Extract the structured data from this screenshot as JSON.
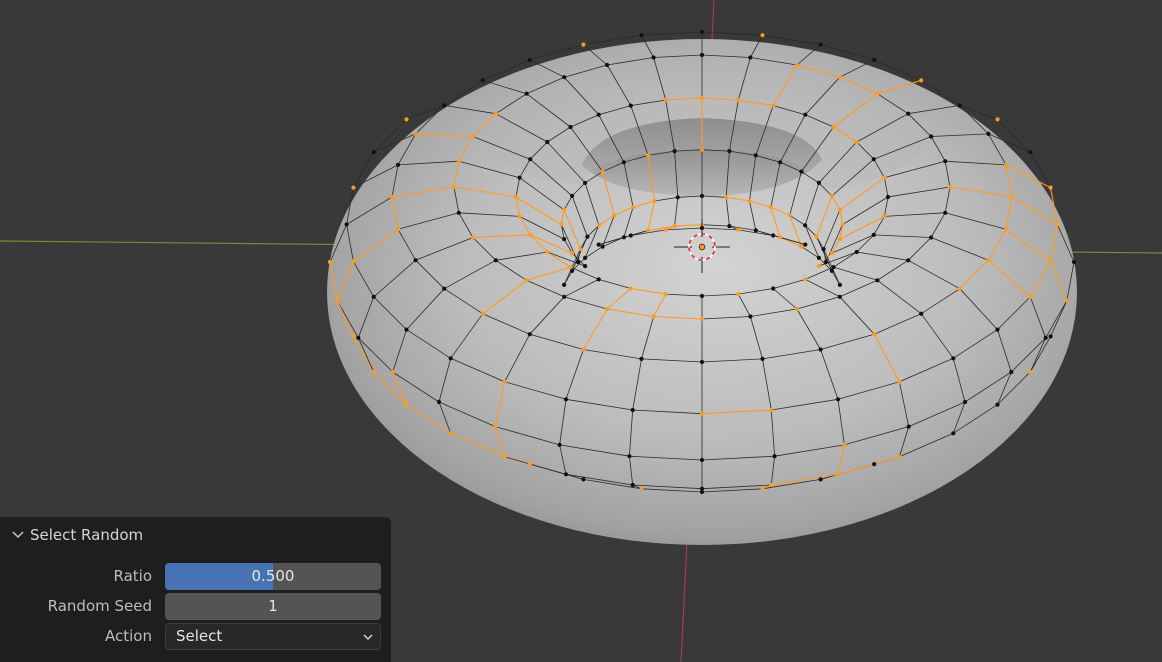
{
  "viewport": {
    "background": "#393939",
    "x_axis_color": "#7a9a3c",
    "y_axis_color": "#b3414a",
    "mesh_color_selected": "#ff9a1f",
    "mesh_color_unselected": "#111111",
    "object": "torus",
    "selection_ratio": 0.5
  },
  "operator_panel": {
    "title": "Select Random",
    "collapse_icon": "chevron-down-icon",
    "ratio": {
      "label": "Ratio",
      "value": "0.500",
      "fraction": 0.5
    },
    "seed": {
      "label": "Random Seed",
      "value": "1"
    },
    "action": {
      "label": "Action",
      "value": "Select",
      "dropdown_icon": "chevron-down-icon"
    }
  }
}
